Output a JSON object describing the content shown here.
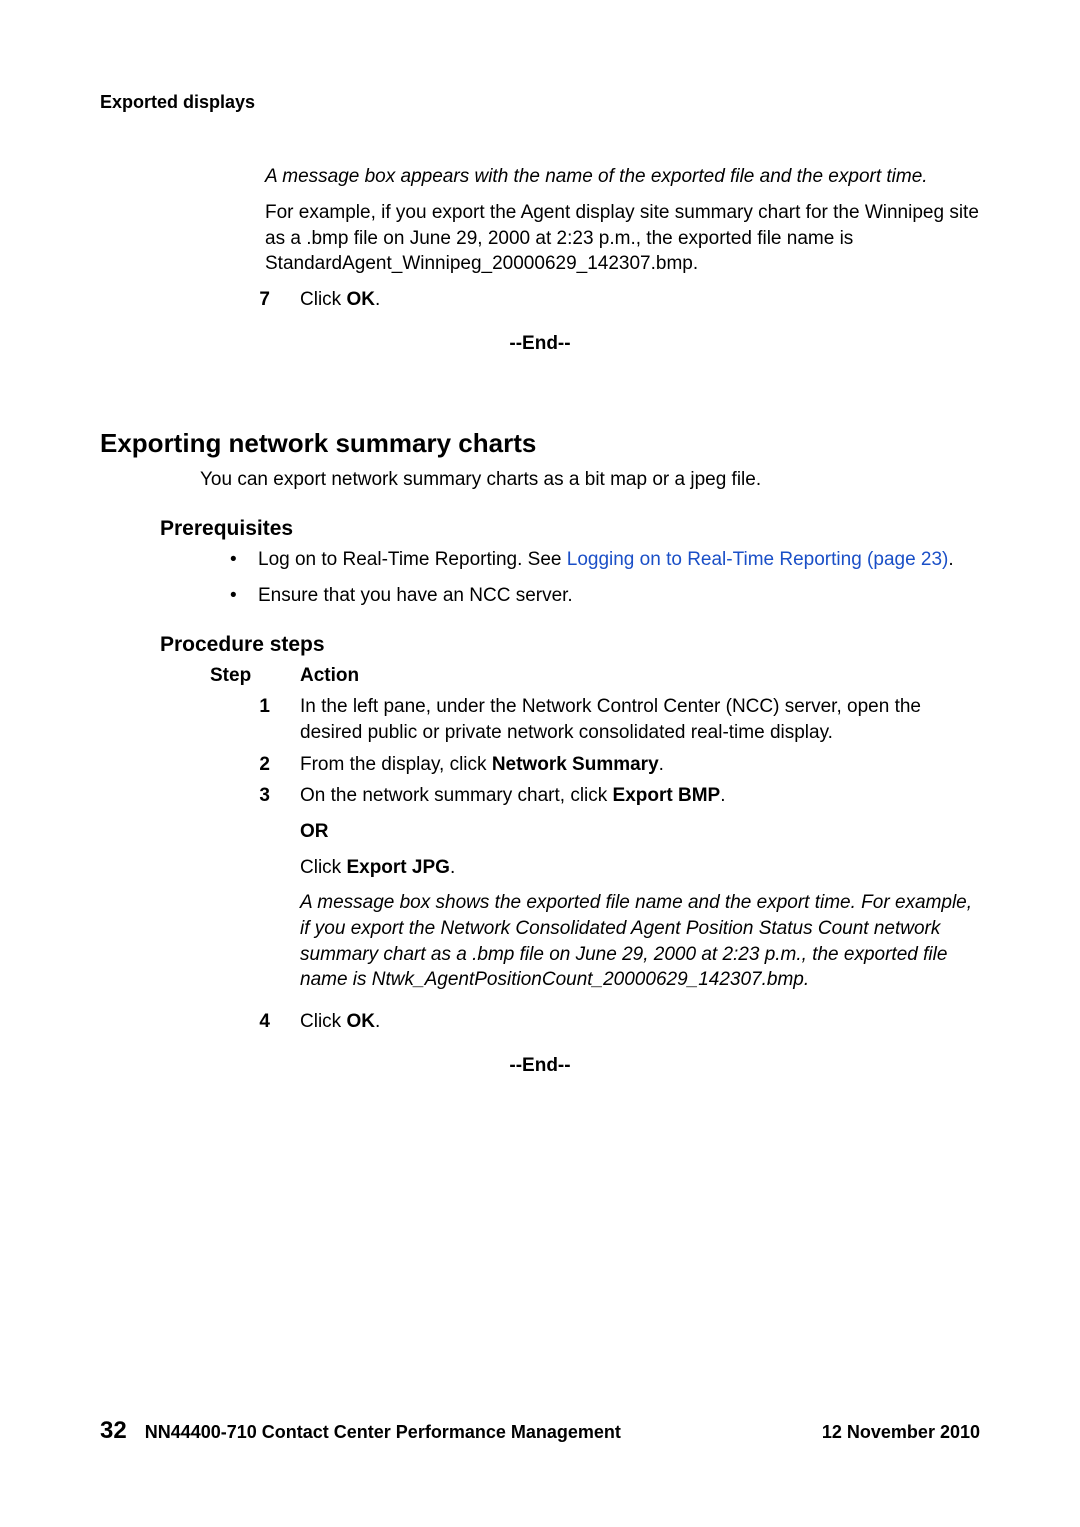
{
  "running_head": "Exported displays",
  "intro_block": {
    "message_italic": "A message box appears with the name of the exported file and the export time.",
    "example": "For example, if you export the Agent display site summary chart for the Winnipeg site as a .bmp file on June 29, 2000 at 2:23 p.m., the exported file name is StandardAgent_Winnipeg_20000629_142307.bmp."
  },
  "step7": {
    "num": "7",
    "pre": "Click ",
    "bold": "OK",
    "post": "."
  },
  "end_label": "--End--",
  "section2": {
    "title": "Exporting network summary charts",
    "intro": "You can export network summary charts as a bit map or a jpeg file.",
    "prereq_title": "Prerequisites",
    "prereq1_pre": "Log on to Real-Time Reporting. See ",
    "prereq1_link": "Logging on to Real-Time Reporting (page 23)",
    "prereq1_post": ".",
    "prereq2": "Ensure that you have an NCC server.",
    "proc_title": "Procedure steps",
    "col_step": "Step",
    "col_action": "Action",
    "s1": {
      "num": "1",
      "text": "In the left pane, under the Network Control Center (NCC) server, open the desired public or private network consolidated real-time display."
    },
    "s2": {
      "num": "2",
      "pre": "From the display, click ",
      "bold": "Network Summary",
      "post": "."
    },
    "s3": {
      "num": "3",
      "l1_pre": "On the network summary chart, click ",
      "l1_bold": "Export BMP",
      "l1_post": ".",
      "or": "OR",
      "l2_pre": "Click ",
      "l2_bold": "Export JPG",
      "l2_post": ".",
      "italic": "A message box shows the exported file name and the export time. For example, if you export the Network Consolidated Agent Position Status Count network summary chart as a .bmp file on June 29, 2000 at 2:23 p.m., the exported file name is Ntwk_AgentPositionCount_20000629_142307.bmp."
    },
    "s4": {
      "num": "4",
      "pre": "Click ",
      "bold": "OK",
      "post": "."
    }
  },
  "footer": {
    "page": "32",
    "doc": "NN44400-710 Contact Center Performance Management",
    "date": "12 November 2010"
  }
}
